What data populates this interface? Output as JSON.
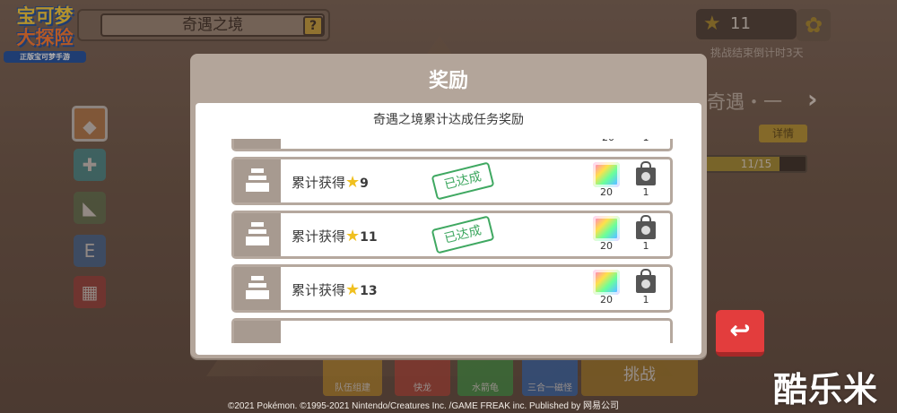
{
  "logo": {
    "line1": "宝可梦",
    "line2": "大探险",
    "tagline": "正版宝可梦手游"
  },
  "header": {
    "title": "奇遇之境",
    "help_label": "?"
  },
  "currency": {
    "star_count": "11",
    "countdown": "挑战结束倒计时3天"
  },
  "right_panel": {
    "title": "奇遇・一",
    "details_label": "详情",
    "progress_text": "11/15",
    "progress_fraction": 0.733
  },
  "modal": {
    "title": "奖励",
    "subtitle": "奇遇之境累计达成任务奖励",
    "rows": [
      {
        "label": "",
        "num": "",
        "completed": false,
        "reward1_count": "20",
        "reward2_count": "1"
      },
      {
        "label": "累计获得",
        "num": "9",
        "completed": true,
        "stamp": "已达成",
        "reward1_count": "20",
        "reward2_count": "1"
      },
      {
        "label": "累计获得",
        "num": "11",
        "completed": true,
        "stamp": "已达成",
        "reward1_count": "20",
        "reward2_count": "1"
      },
      {
        "label": "累计获得",
        "num": "13",
        "completed": false,
        "reward1_count": "20",
        "reward2_count": "1"
      }
    ]
  },
  "bottom_bar": {
    "items": [
      {
        "label": "队伍组建",
        "color": "#c9962c"
      },
      {
        "label": "快龙",
        "color": "#c0443a"
      },
      {
        "label": "水箭龟",
        "color": "#3fa44a"
      },
      {
        "label": "三合一磁怪",
        "color": "#2f6fc9"
      }
    ],
    "challenge_label": "挑战"
  },
  "back_button": {
    "icon": "return-arrow-icon",
    "glyph": "↩"
  },
  "footer": {
    "copyright": "©2021 Pokémon. ©1995-2021 Nintendo/Creatures Inc. /GAME FREAK inc. Published by 网易公司"
  },
  "watermark": "酷乐米",
  "colors": {
    "modal_frame": "#b3a59a",
    "row_border": "#b5a89e",
    "stamp_green": "#3fa861",
    "back_red": "#e33d3d",
    "gold_star": "#f0c020"
  }
}
